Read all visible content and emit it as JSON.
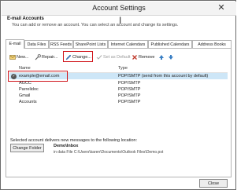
{
  "window": {
    "title": "Account Settings",
    "close_glyph": "✕"
  },
  "header": {
    "title": "E-mail Accounts",
    "subtitle": "You can add or remove an account. You can select an account and change its settings."
  },
  "tabs": [
    {
      "label": "E-mail",
      "active": true
    },
    {
      "label": "Data Files"
    },
    {
      "label": "RSS Feeds"
    },
    {
      "label": "SharePoint Lists"
    },
    {
      "label": "Internet Calendars"
    },
    {
      "label": "Published Calendars"
    },
    {
      "label": "Address Books"
    }
  ],
  "toolbar": {
    "new_label": "New...",
    "repair_label": "Repair...",
    "change_label": "Change...",
    "set_default_label": "Set as Default",
    "remove_label": "Remove"
  },
  "table": {
    "col_name": "Name",
    "col_type": "Type",
    "rows": [
      {
        "name": "example@email.com",
        "type": "POP/SMTP (send from this account by default)",
        "selected": true
      },
      {
        "name": "AGCC",
        "type": "POP/SMTP"
      },
      {
        "name": "Parrelidoc",
        "type": "POP/SMTP"
      },
      {
        "name": "Gmail",
        "type": "POP/SMTP"
      },
      {
        "name": "Accounts",
        "type": "POP/SMTP"
      }
    ]
  },
  "delivery": {
    "label": "Selected account delivers new messages to the following location:",
    "change_folder_label": "Change Folder",
    "folder": "Demo\\Inbox",
    "path": "in data File C:\\Users\\karen\\Documents\\Outlook Files\\Demo.pst"
  },
  "footer": {
    "close_label": "Close"
  },
  "colors": {
    "accent": "#d0151b",
    "selection": "#cde6f7"
  }
}
